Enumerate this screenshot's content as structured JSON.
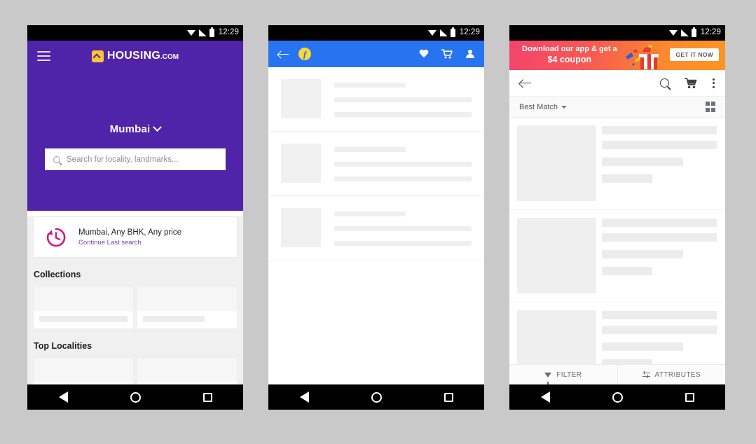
{
  "status_bar": {
    "time": "12:29",
    "icons": [
      "wifi-icon",
      "signal-icon",
      "battery-icon"
    ]
  },
  "nav_bar": {
    "back": "back-triangle-icon",
    "home": "home-circle-icon",
    "recents": "recents-square-icon"
  },
  "colors": {
    "housing_purple": "#5024a8",
    "housing_yellow": "#fdc62e",
    "housing_link": "#6d3fbf",
    "housing_clock": "#d6157f",
    "flipkart_blue": "#2874f0",
    "flipkart_yellow": "#fdd835",
    "banner_pink": "#f4436c",
    "banner_orange": "#fb9524",
    "skeleton_gray": "#efefef"
  },
  "phone1": {
    "app_name": "Housing.com",
    "menu_icon": "hamburger-menu-icon",
    "logo": {
      "mark": "housing-roof-icon",
      "name": "HOUSING",
      "suffix": ".COM"
    },
    "city": {
      "label": "Mumbai",
      "caret": "chevron-down-icon"
    },
    "search": {
      "icon": "search-icon",
      "placeholder": "Search for locality, landmarks..."
    },
    "recent_search": {
      "icon": "history-clock-icon",
      "title": "Mumbai, Any BHK, Any price",
      "action": "Continue Last search"
    },
    "sections": [
      {
        "title": "Collections",
        "cards": [
          "wide",
          "narrow"
        ]
      },
      {
        "title": "Top Localities",
        "cards": [
          "wide",
          "narrow"
        ]
      }
    ]
  },
  "phone2": {
    "app_name": "Flipkart",
    "back_icon": "back-arrow-icon",
    "logo_letter": "f",
    "actions": [
      {
        "name": "wishlist-heart-icon"
      },
      {
        "name": "cart-icon"
      },
      {
        "name": "account-person-icon"
      }
    ],
    "skeleton_rows": 3
  },
  "phone3": {
    "banner": {
      "line1": "Download our app & get a",
      "line2": "$4 coupon",
      "cta": "GET IT NOW",
      "art": "gift-box-icon"
    },
    "toolbar": {
      "back_icon": "back-arrow-icon",
      "search_icon": "search-icon",
      "cart_icon": "cart-icon",
      "overflow_icon": "more-vertical-icon"
    },
    "sort_bar": {
      "sort_label": "Best Match",
      "caret": "dropdown-caret-icon",
      "view_toggle": "grid-view-icon"
    },
    "bottom_bar": [
      {
        "label": "FILTER",
        "icon": "funnel-icon"
      },
      {
        "label": "ATTRIBUTES",
        "icon": "attributes-sliders-icon"
      }
    ],
    "skeleton_rows": 3
  }
}
